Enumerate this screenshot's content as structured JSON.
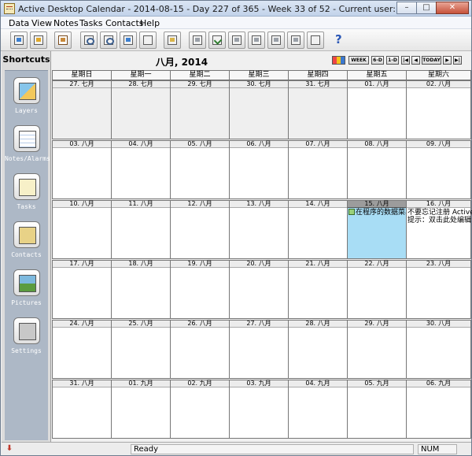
{
  "window": {
    "title": "Active Desktop Calendar - 2014-08-15 - Day 227 of 365 - Week 33 of 52 - Current user: Administrator",
    "controls": [
      "minimize",
      "maximize",
      "close"
    ]
  },
  "menu": [
    "Data",
    "View",
    "Notes",
    "Tasks",
    "Contacts",
    "Help"
  ],
  "toolbar": {
    "buttons": [
      "calendar-icon",
      "alarm-icon",
      "print-icon",
      "search-icon",
      "find-next-icon",
      "layer-icon",
      "delete-icon",
      "task-icon",
      "edit-icon",
      "check-icon",
      "move-up-icon",
      "move-down-icon",
      "filter-icon",
      "clipboard-icon",
      "remove-icon",
      "help-icon"
    ],
    "help_label": "?"
  },
  "shortcuts": {
    "title": "Shortcuts",
    "items": [
      {
        "label": "Layers",
        "icon": "layers-icon"
      },
      {
        "label": "Notes/Alarms",
        "icon": "notes-alarms-icon"
      },
      {
        "label": "Tasks",
        "icon": "tasks-icon"
      },
      {
        "label": "Contacts",
        "icon": "contacts-icon"
      },
      {
        "label": "Pictures",
        "icon": "pictures-icon"
      },
      {
        "label": "Settings",
        "icon": "settings-icon"
      }
    ]
  },
  "calendar": {
    "month_title": "八月, 2014",
    "nav": {
      "color": "",
      "week": "WEEK",
      "six_d": "6-D",
      "one_d": "1-D",
      "first": "|◀",
      "prev": "◀",
      "today": "TODAY",
      "next": "▶",
      "last": "▶|"
    },
    "weekdays": [
      "星期日",
      "星期一",
      "星期二",
      "星期三",
      "星期四",
      "星期五",
      "星期六"
    ],
    "weeks": [
      [
        {
          "label": "27. 七月",
          "prev": true
        },
        {
          "label": "28. 七月",
          "prev": true
        },
        {
          "label": "29. 七月",
          "prev": true
        },
        {
          "label": "30. 七月",
          "prev": true
        },
        {
          "label": "31. 七月",
          "prev": true
        },
        {
          "label": "01. 八月"
        },
        {
          "label": "02. 八月"
        }
      ],
      [
        {
          "label": "03. 八月"
        },
        {
          "label": "04. 八月"
        },
        {
          "label": "05. 八月"
        },
        {
          "label": "06. 八月"
        },
        {
          "label": "07. 八月"
        },
        {
          "label": "08. 八月"
        },
        {
          "label": "09. 八月"
        }
      ],
      [
        {
          "label": "10. 八月"
        },
        {
          "label": "11. 八月"
        },
        {
          "label": "12. 八月"
        },
        {
          "label": "13. 八月"
        },
        {
          "label": "14. 八月"
        },
        {
          "label": "15. 八月",
          "selected": true,
          "event": "在程序的数据菜单"
        },
        {
          "label": "16. 八月",
          "notes": [
            "不要忘记注册 Active D",
            "提示：双击此处编辑"
          ]
        }
      ],
      [
        {
          "label": "17. 八月"
        },
        {
          "label": "18. 八月"
        },
        {
          "label": "19. 八月"
        },
        {
          "label": "20. 八月"
        },
        {
          "label": "21. 八月"
        },
        {
          "label": "22. 八月"
        },
        {
          "label": "23. 八月"
        }
      ],
      [
        {
          "label": "24. 八月"
        },
        {
          "label": "25. 八月"
        },
        {
          "label": "26. 八月"
        },
        {
          "label": "27. 八月"
        },
        {
          "label": "28. 八月"
        },
        {
          "label": "29. 八月"
        },
        {
          "label": "30. 八月"
        }
      ],
      [
        {
          "label": "31. 八月"
        },
        {
          "label": "01. 九月"
        },
        {
          "label": "02. 九月"
        },
        {
          "label": "03. 九月"
        },
        {
          "label": "04. 九月"
        },
        {
          "label": "05. 九月"
        },
        {
          "label": "06. 九月"
        }
      ]
    ]
  },
  "status": {
    "ready": "Ready",
    "num": "NUM",
    "icon": "record-icon"
  }
}
